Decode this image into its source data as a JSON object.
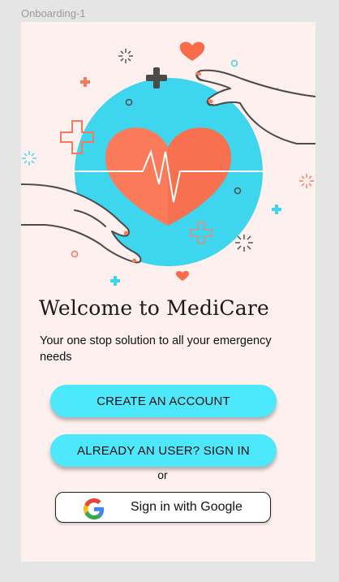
{
  "frame": {
    "label": "Onboarding-1"
  },
  "welcome": {
    "title": "Welcome to MediCare",
    "subtitle": "Your one stop solution to all your emergency needs"
  },
  "actions": {
    "create_account": "CREATE AN ACCOUNT",
    "sign_in": "ALREADY AN USER? SIGN IN",
    "or": "or",
    "google": "Sign in with Google"
  },
  "colors": {
    "screen_bg": "#fdf0ee",
    "accent_cyan": "#4de8fb",
    "heart": "#fb7a5a",
    "circle": "#3dd6ee"
  },
  "icons": [
    "heart-illustration",
    "google-icon"
  ]
}
